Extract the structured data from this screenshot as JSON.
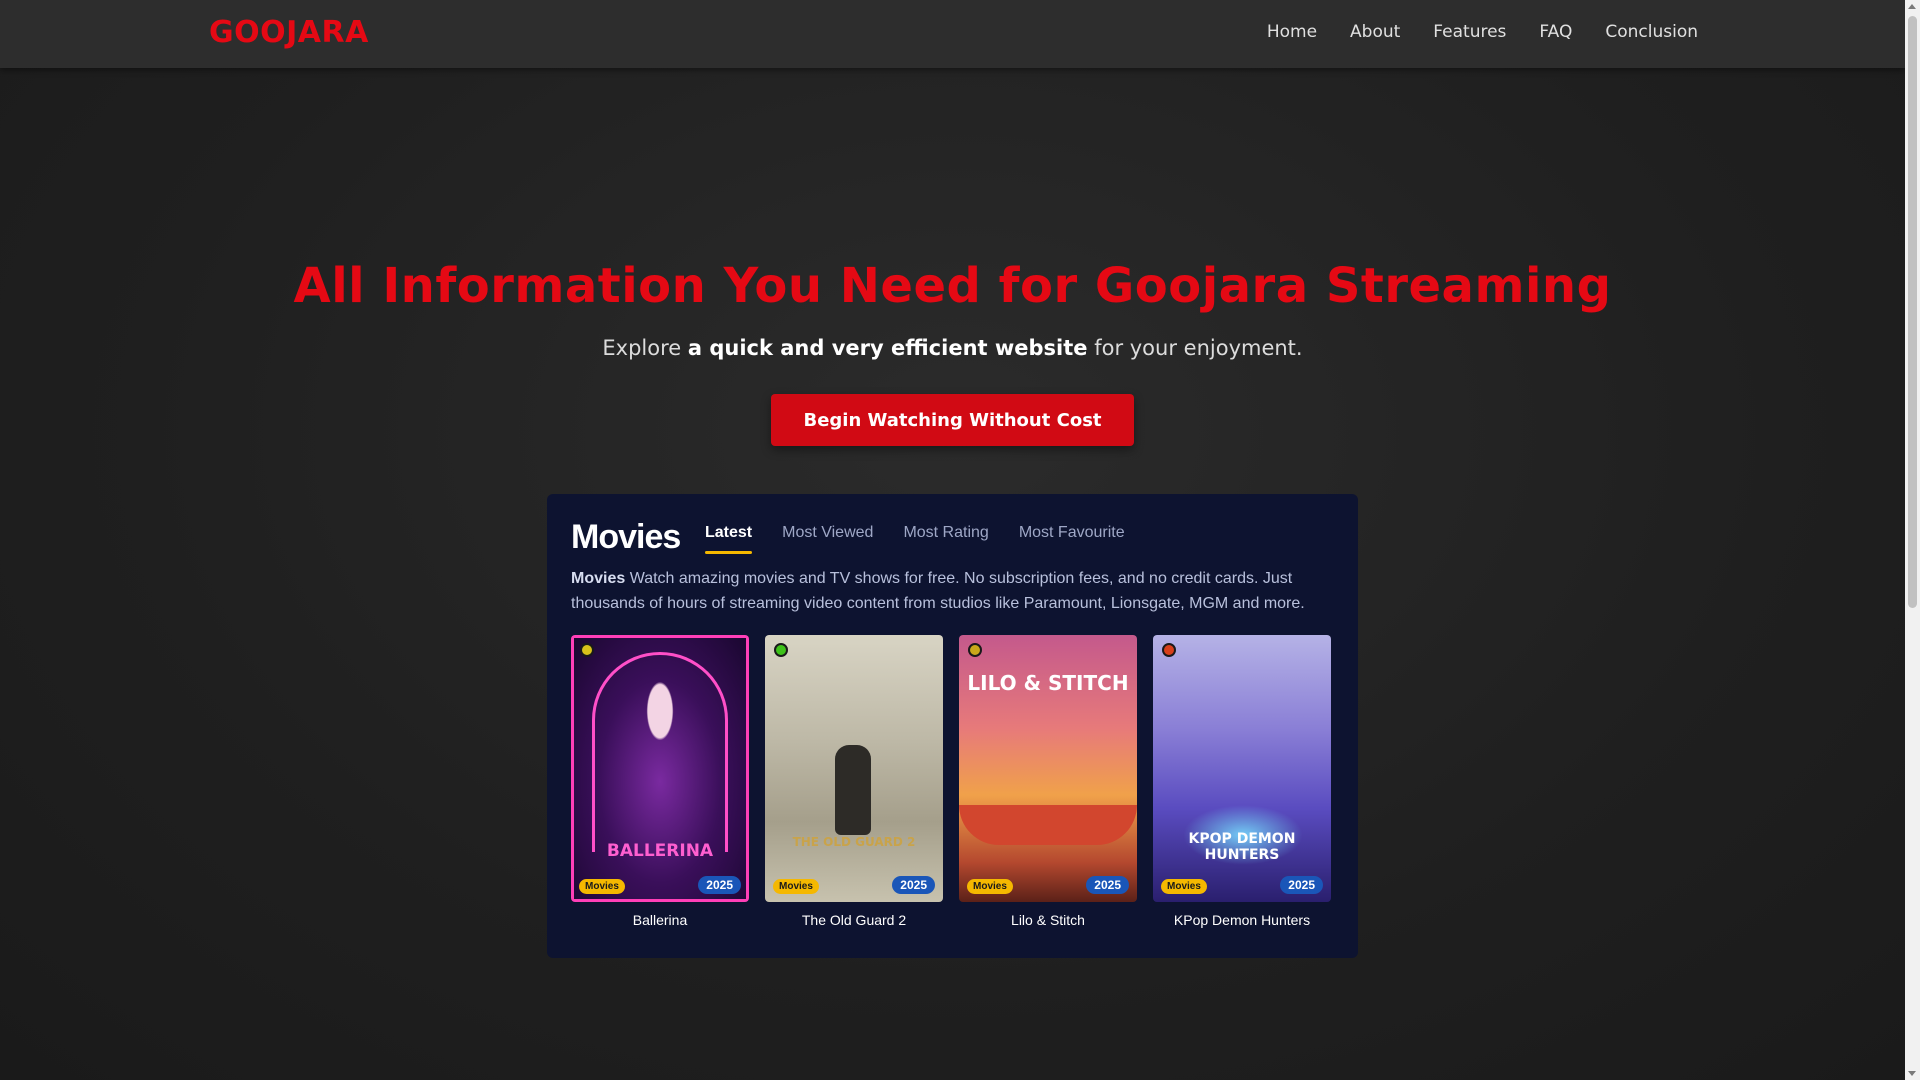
{
  "nav": {
    "brand": "GOOJARA",
    "links": [
      "Home",
      "About",
      "Features",
      "FAQ",
      "Conclusion"
    ]
  },
  "hero": {
    "title": "All Information You Need for Goojara Streaming",
    "subtitle_pre": "Explore ",
    "subtitle_bold": "a quick and very efficient website",
    "subtitle_post": " for your enjoyment.",
    "cta": "Begin Watching Without Cost"
  },
  "panel": {
    "title": "Movies",
    "tabs": [
      "Latest",
      "Most Viewed",
      "Most Rating",
      "Most Favourite"
    ],
    "active_tab": "Latest",
    "desc_bold": "Movies",
    "desc": " Watch amazing movies and TV shows for free. No subscription fees, and no credit cards. Just thousands of hours of streaming video content from studios like Paramount, Lionsgate, MGM and more.",
    "cards": [
      {
        "title": "Ballerina",
        "type": "Movies",
        "year": "2025",
        "poster_text": "BALLERINA",
        "dot_color": "#d8c21a"
      },
      {
        "title": "The Old Guard 2",
        "type": "Movies",
        "year": "2025",
        "poster_text": "THE OLD GUARD 2",
        "dot_color": "#3ec21a"
      },
      {
        "title": "Lilo & Stitch",
        "type": "Movies",
        "year": "2025",
        "poster_text": "LILO & STITCH",
        "dot_color": "#c9a81a"
      },
      {
        "title": "KPop Demon Hunters",
        "type": "Movies",
        "year": "2025",
        "poster_text": "KPOP DEMON HUNTERS",
        "dot_color": "#d8401a"
      }
    ]
  },
  "colors": {
    "accent": "#e50914",
    "tab_underline": "#f5b800",
    "panel_bg": "#0d1330"
  }
}
